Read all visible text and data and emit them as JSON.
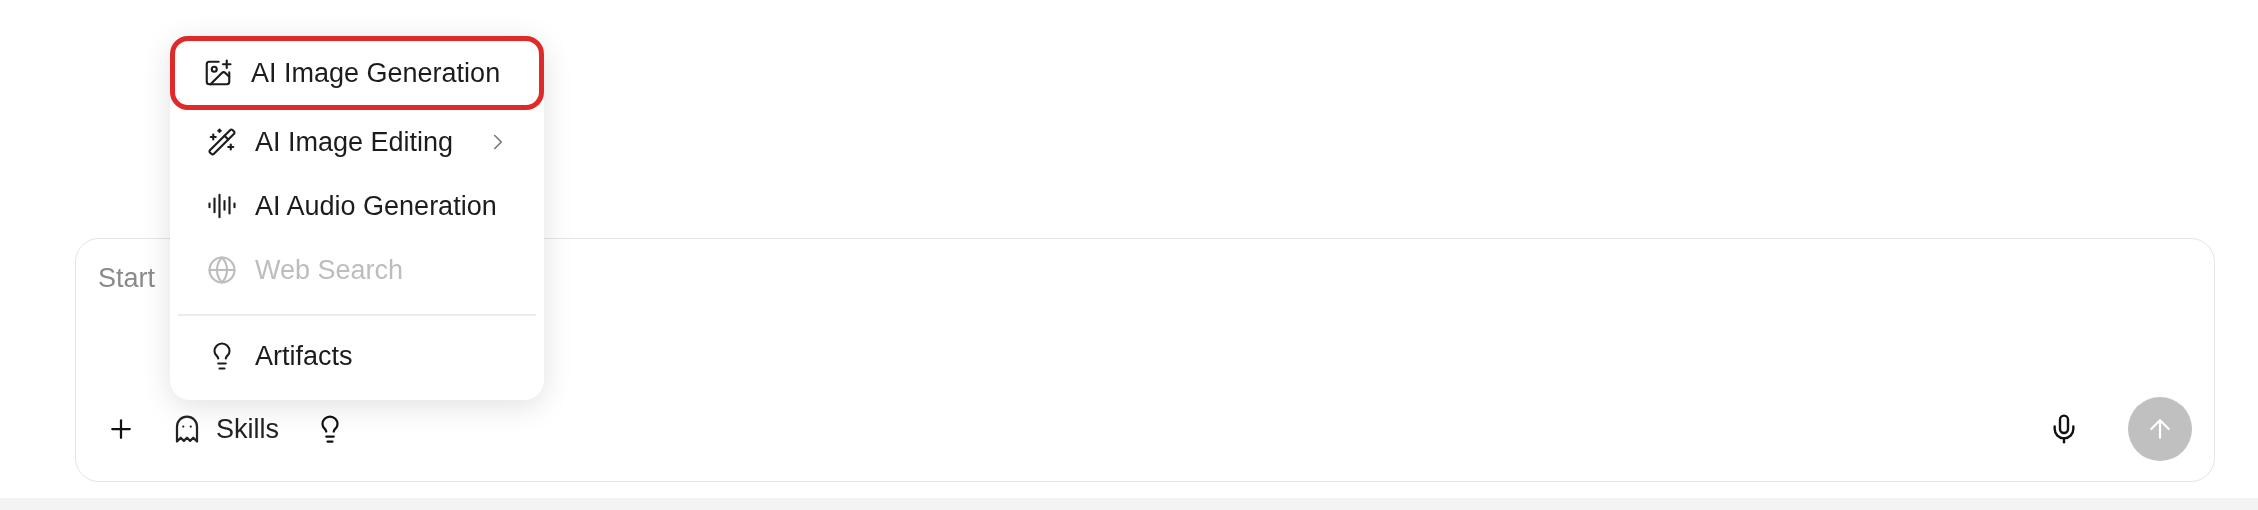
{
  "composer": {
    "placeholder": "Start",
    "skills_label": "Skills",
    "send_disabled": true
  },
  "menu": {
    "sections": [
      [
        {
          "label": "AI Image Generation",
          "highlighted": true,
          "disabled": false,
          "submenu": false
        },
        {
          "label": "AI Image Editing",
          "highlighted": false,
          "disabled": false,
          "submenu": true
        },
        {
          "label": "AI Audio Generation",
          "highlighted": false,
          "disabled": false,
          "submenu": false
        },
        {
          "label": "Web Search",
          "highlighted": false,
          "disabled": true,
          "submenu": false
        }
      ],
      [
        {
          "label": "Artifacts",
          "highlighted": false,
          "disabled": false,
          "submenu": false
        }
      ]
    ]
  }
}
